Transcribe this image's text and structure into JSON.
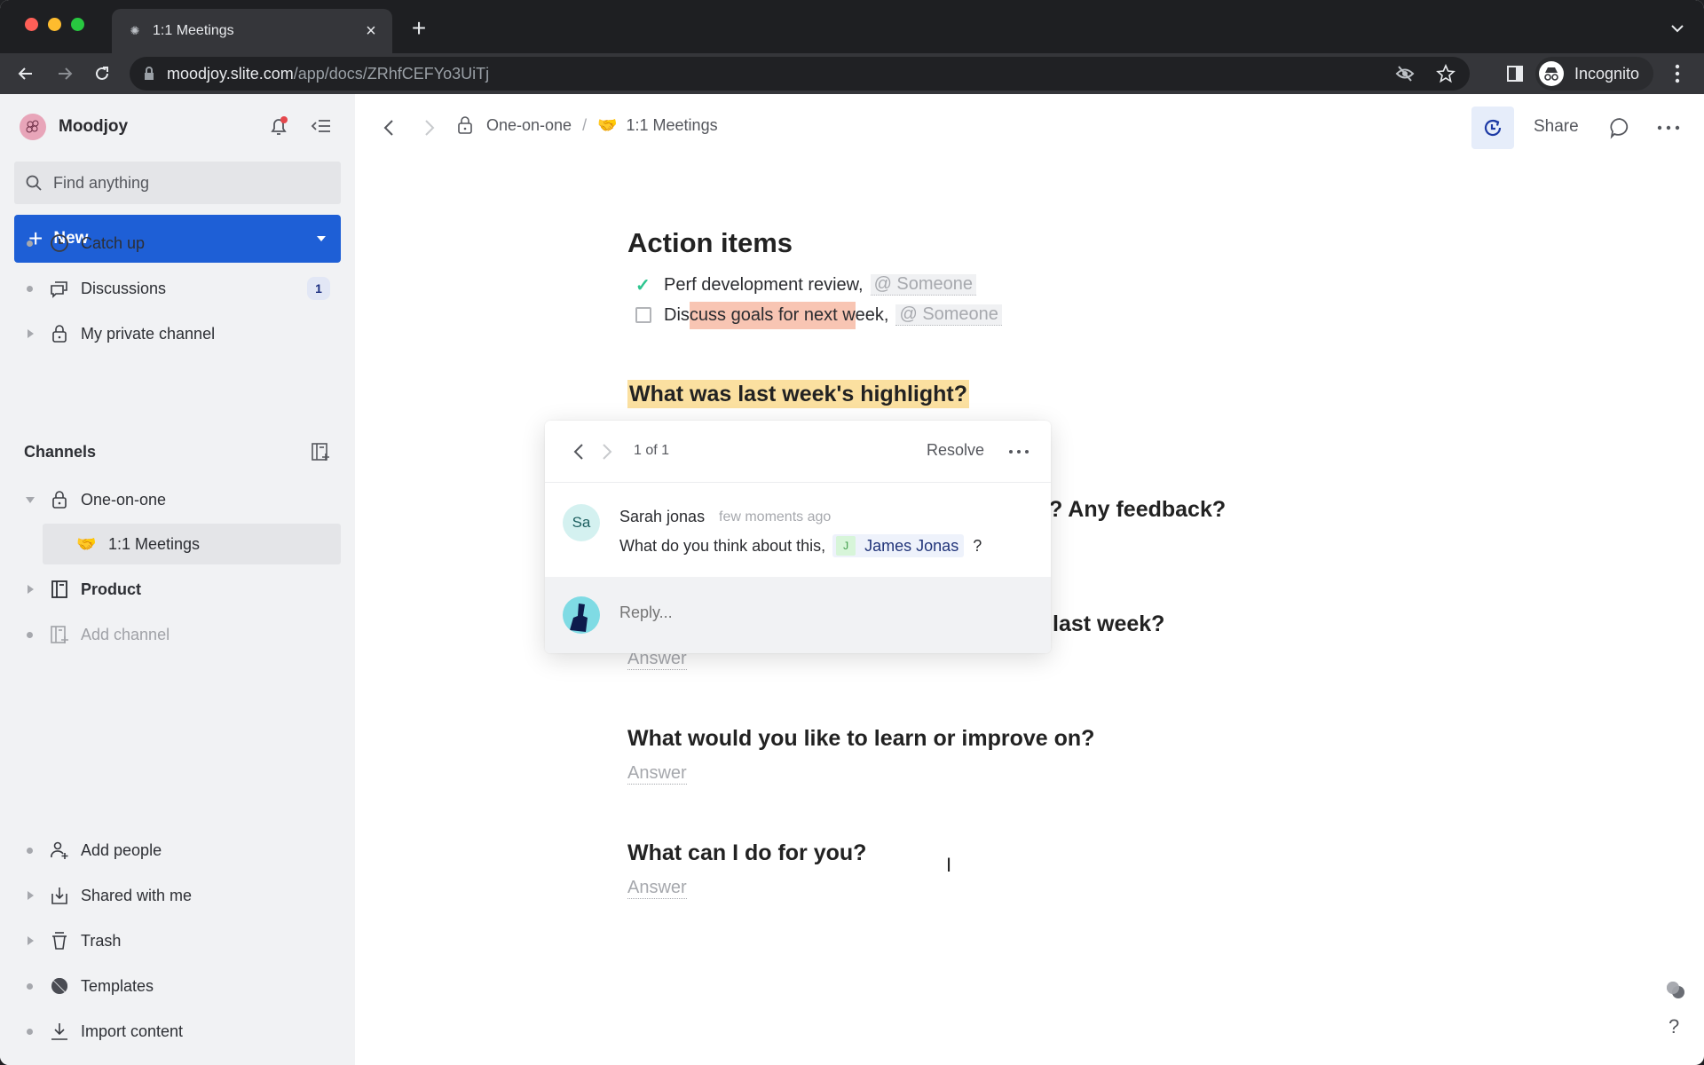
{
  "browser": {
    "tab_title": "1:1 Meetings",
    "url_host": "moodjoy.slite.com",
    "url_path": "/app/docs/ZRhfCEFYo3UiTj",
    "profile_label": "Incognito"
  },
  "sidebar": {
    "workspace_name": "Moodjoy",
    "search_placeholder": "Find anything",
    "new_button": "New",
    "top_items": [
      {
        "label": "Catch up",
        "icon": "clock-icon"
      },
      {
        "label": "Discussions",
        "icon": "chat-bubbles-icon",
        "badge": "1"
      },
      {
        "label": "My private channel",
        "icon": "lock-icon"
      }
    ],
    "channels_title": "Channels",
    "channels": [
      {
        "label": "One-on-one",
        "icon": "lock-icon",
        "expanded": true
      },
      {
        "label": "1:1 Meetings",
        "icon": "handshake-emoji",
        "emoji": "🤝",
        "selected": true
      },
      {
        "label": "Product",
        "icon": "doc-channel-icon"
      },
      {
        "label": "Add channel",
        "icon": "add-channel-icon"
      }
    ],
    "bottom_items": [
      {
        "label": "Add people",
        "icon": "add-user-icon"
      },
      {
        "label": "Shared with me",
        "icon": "inbox-download-icon"
      },
      {
        "label": "Trash",
        "icon": "trash-icon"
      },
      {
        "label": "Templates",
        "icon": "templates-icon"
      },
      {
        "label": "Import content",
        "icon": "import-icon"
      }
    ]
  },
  "header": {
    "breadcrumb_parent": "One-on-one",
    "breadcrumb_separator": "/",
    "breadcrumb_emoji": "🤝",
    "breadcrumb_current": "1:1 Meetings",
    "share_label": "Share"
  },
  "doc": {
    "action_items_title": "Action items",
    "todos": [
      {
        "text": "Perf development review,",
        "mention": "@ Someone",
        "done": true
      },
      {
        "text_pre": "Dis",
        "text_highlight": "cuss goals for next w",
        "text_post": "eek,",
        "mention": "@ Someone",
        "done": false
      }
    ],
    "questions": [
      {
        "text": "What was last week's highlight?",
        "highlighted": true
      },
      {
        "text_visible": "? Any feedback?"
      },
      {
        "text_visible": "last week?",
        "answer": "Answer"
      },
      {
        "text": "What would you like to learn or improve on?",
        "answer": "Answer"
      },
      {
        "text": "What can I do for you?",
        "answer": "Answer"
      }
    ]
  },
  "comment_popover": {
    "counter": "1 of 1",
    "resolve_label": "Resolve",
    "comment": {
      "avatar_initials": "Sa",
      "author": "Sarah jonas",
      "time": "few moments ago",
      "body_pre": "What do you think about this,",
      "mention_initial": "J",
      "mention_name": "James Jonas",
      "body_post": "?"
    },
    "reply_placeholder": "Reply..."
  },
  "misc": {
    "help_label": "?"
  },
  "colors": {
    "accent": "#1e5fd6",
    "sidebar_bg": "#f1f2f4",
    "highlight_yellow": "#fbe0a0",
    "highlight_red": "#f8c5b3",
    "check_green": "#2dc58f"
  }
}
